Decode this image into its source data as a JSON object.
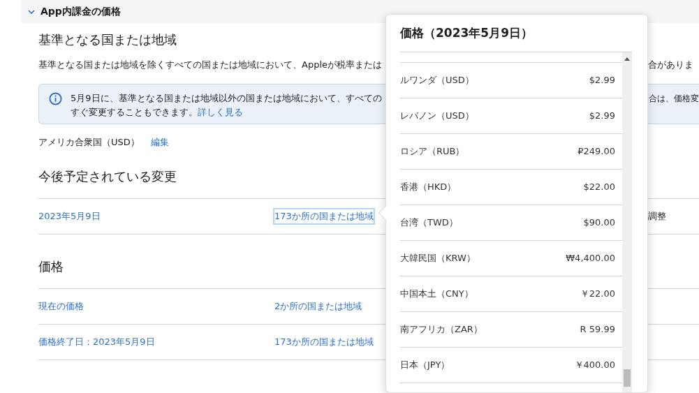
{
  "section": {
    "title": "App内課金の価格",
    "expanded": true
  },
  "base": {
    "heading": "基準となる国または地域",
    "description_left": "基準となる国または地域を除くすべての国または地域において、Appleが税率または",
    "description_right": "合がありま",
    "info": {
      "line1_left": "5月9日に、基準となる国または地域以外の国または地域において、すべての",
      "line1_right": "合は、価格変",
      "line2": "すぐ変更することもできます。",
      "link": "詳しく見る"
    },
    "country": "アメリカ合衆国（USD）",
    "edit": "編集"
  },
  "upcoming": {
    "heading": "今後予定されている変更",
    "rows": [
      {
        "date": "2023年5月9日",
        "regions": "173か所の国または地域",
        "selected": true,
        "extra": "調整"
      }
    ]
  },
  "prices": {
    "heading": "価格",
    "rows": [
      {
        "date": "現在の価格",
        "regions": "2か所の国または地域",
        "selected": false
      },
      {
        "date": "価格終了日：2023年5月9日",
        "regions": "173か所の国または地域",
        "selected": false
      }
    ]
  },
  "popover": {
    "title": "価格（2023年5月9日）",
    "rows": [
      {
        "country": "ルワンダ（USD）",
        "price": "$2.99"
      },
      {
        "country": "レバノン（USD）",
        "price": "$2.99"
      },
      {
        "country": "ロシア（RUB）",
        "price": "₽249.00"
      },
      {
        "country": "香港（HKD）",
        "price": "$22.00"
      },
      {
        "country": "台湾（TWD）",
        "price": "$90.00"
      },
      {
        "country": "大韓民国（KRW）",
        "price": "₩4,400.00"
      },
      {
        "country": "中国本土（CNY）",
        "price": "￥22.00"
      },
      {
        "country": "南アフリカ（ZAR）",
        "price": "R 59.99"
      },
      {
        "country": "日本（JPY）",
        "price": "￥400.00"
      }
    ]
  }
}
